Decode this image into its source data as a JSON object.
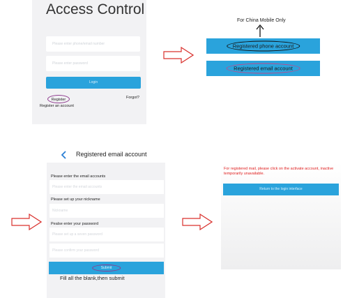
{
  "login": {
    "title": "Access Control",
    "phone_placeholder": "Please enter phone/email number",
    "password_placeholder": "Please enter password",
    "login_label": "Login",
    "register_label": "Register",
    "forgot_label": "Forgot?",
    "register_hint": "Register an account"
  },
  "account_type": {
    "note": "For China Mobile Only",
    "phone_label": "Registered phone account",
    "email_label": "Registered email account"
  },
  "email_form": {
    "title": "Registered email account",
    "email_label": "Please enter the email accounts",
    "email_placeholder": "Please enter the email accounts",
    "nickname_label": "Please set up your nickname",
    "nickname_placeholder": "Nickname",
    "password_label": "Pealse enter your password",
    "password_placeholder": "Please set up a seven password",
    "confirm_placeholder": "Please confirm your password",
    "submit_label": "Submit",
    "instruction": "Fill all the blank,then submit"
  },
  "activation": {
    "message": "For registered mail, please click on the activate account, inactive temporarily unavailable.",
    "return_label": "Return to the login interface"
  },
  "colors": {
    "accent_blue": "#2aa3dc",
    "highlight_circle": "#8e3b8e",
    "warning_red": "#e02020",
    "arrow_red": "#d9302c"
  },
  "icons": {
    "arrow": "right-arrow-outline",
    "up_arrow": "up-arrow",
    "back": "chevron-left"
  }
}
